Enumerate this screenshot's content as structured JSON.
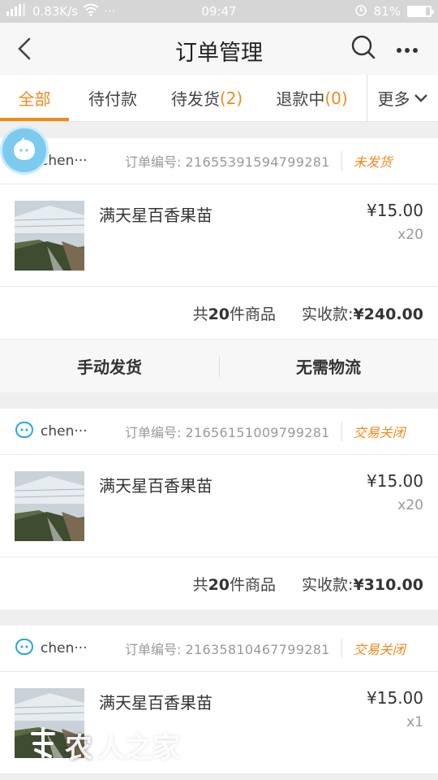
{
  "status_bar": {
    "left_text": "0.83K/s",
    "time": "09:47",
    "battery": "81%",
    "battery_level": 0.81
  },
  "header": {
    "title": "订单管理"
  },
  "tabs": {
    "all": "全部",
    "pending_payment": "待付款",
    "pending_ship": "待发货",
    "pending_ship_count": "(2)",
    "refunding": "退款中",
    "refunding_count": "(0)",
    "more": "更多"
  },
  "orders": [
    {
      "shop": "chen···",
      "order_label": "订单编号:",
      "order_no": "21655391594799281",
      "status": "未发货",
      "item_name": "满天星百香果苗",
      "price": "¥15.00",
      "qty": "x20",
      "total_count_prefix": "共",
      "total_count": "20",
      "total_count_suffix": "件商品",
      "paid_label": "实收款:",
      "paid": "¥240.00",
      "actions": [
        "手动发货",
        "无需物流"
      ]
    },
    {
      "shop": "chen···",
      "order_label": "订单编号:",
      "order_no": "21656151009799281",
      "status": "交易关闭",
      "item_name": "满天星百香果苗",
      "price": "¥15.00",
      "qty": "x20",
      "total_count_prefix": "共",
      "total_count": "20",
      "total_count_suffix": "件商品",
      "paid_label": "实收款:",
      "paid": "¥310.00"
    },
    {
      "shop": "chen···",
      "order_label": "订单编号:",
      "order_no": "21635810467799281",
      "status": "交易关闭",
      "item_name": "满天星百香果苗",
      "price": "¥15.00",
      "qty": "x1"
    }
  ],
  "watermark": {
    "text": "农",
    "faint_text": "人之家"
  },
  "colors": {
    "accent": "#f08a1c",
    "bubble": "#7ccbef",
    "shop_icon": "#29a7e1"
  }
}
